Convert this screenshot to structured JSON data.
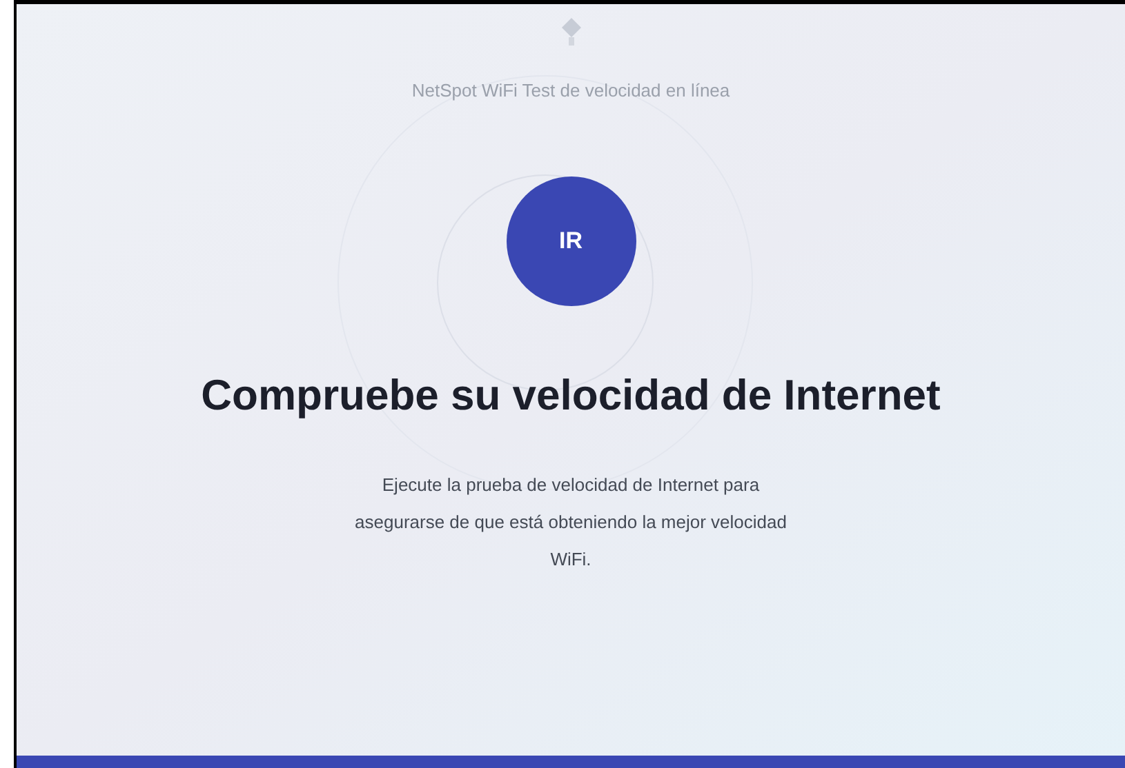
{
  "header": {
    "title": "NetSpot WiFi Test de velocidad en línea"
  },
  "start_button": {
    "label": "IR"
  },
  "heading": "Compruebe su velocidad de Internet",
  "description": "Ejecute la prueba de velocidad de Internet para asegurarse de que está obteniendo la mejor velocidad WiFi."
}
